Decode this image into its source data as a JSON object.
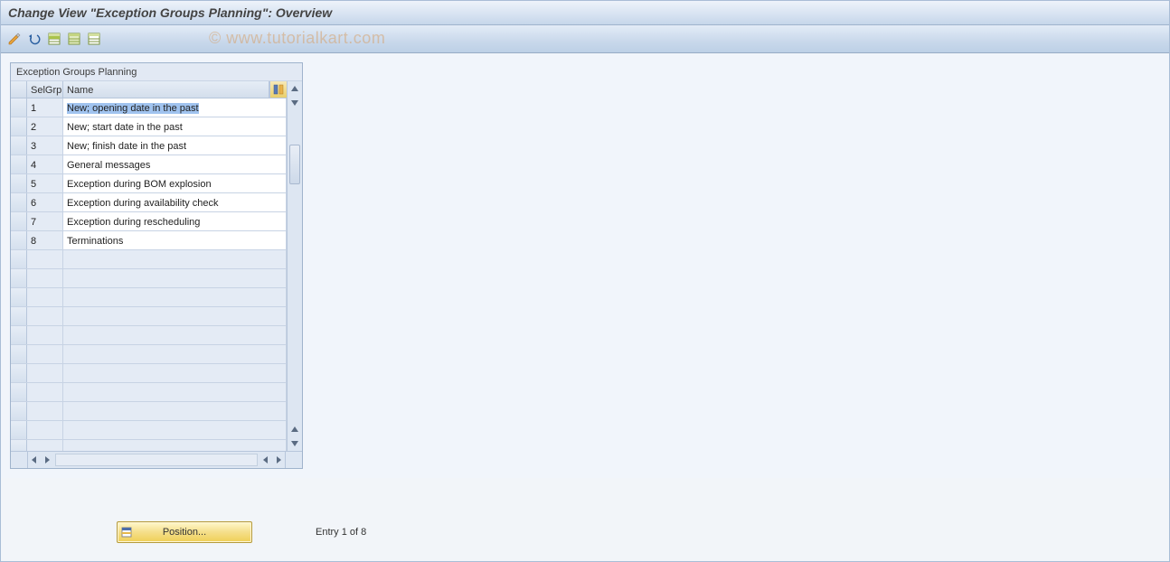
{
  "header": {
    "title": "Change View \"Exception Groups Planning\": Overview"
  },
  "watermark": "© www.tutorialkart.com",
  "toolbar": {
    "icons": [
      "edit-pencil",
      "undo",
      "table-select",
      "table-copy",
      "table-deselect"
    ]
  },
  "panel": {
    "title": "Exception Groups Planning",
    "columns": {
      "mark": "",
      "selgrp": "SelGrp",
      "name": "Name"
    }
  },
  "rows": [
    {
      "selgrp": "1",
      "name": "New; opening date in the past"
    },
    {
      "selgrp": "2",
      "name": "New; start date in the past"
    },
    {
      "selgrp": "3",
      "name": "New; finish date in the past"
    },
    {
      "selgrp": "4",
      "name": "General messages"
    },
    {
      "selgrp": "5",
      "name": "Exception during BOM explosion"
    },
    {
      "selgrp": "6",
      "name": "Exception during availability check"
    },
    {
      "selgrp": "7",
      "name": "Exception during rescheduling"
    },
    {
      "selgrp": "8",
      "name": "Terminations"
    }
  ],
  "empty_rows": 11,
  "footer": {
    "position_label": "Position...",
    "status": "Entry 1 of 8"
  }
}
